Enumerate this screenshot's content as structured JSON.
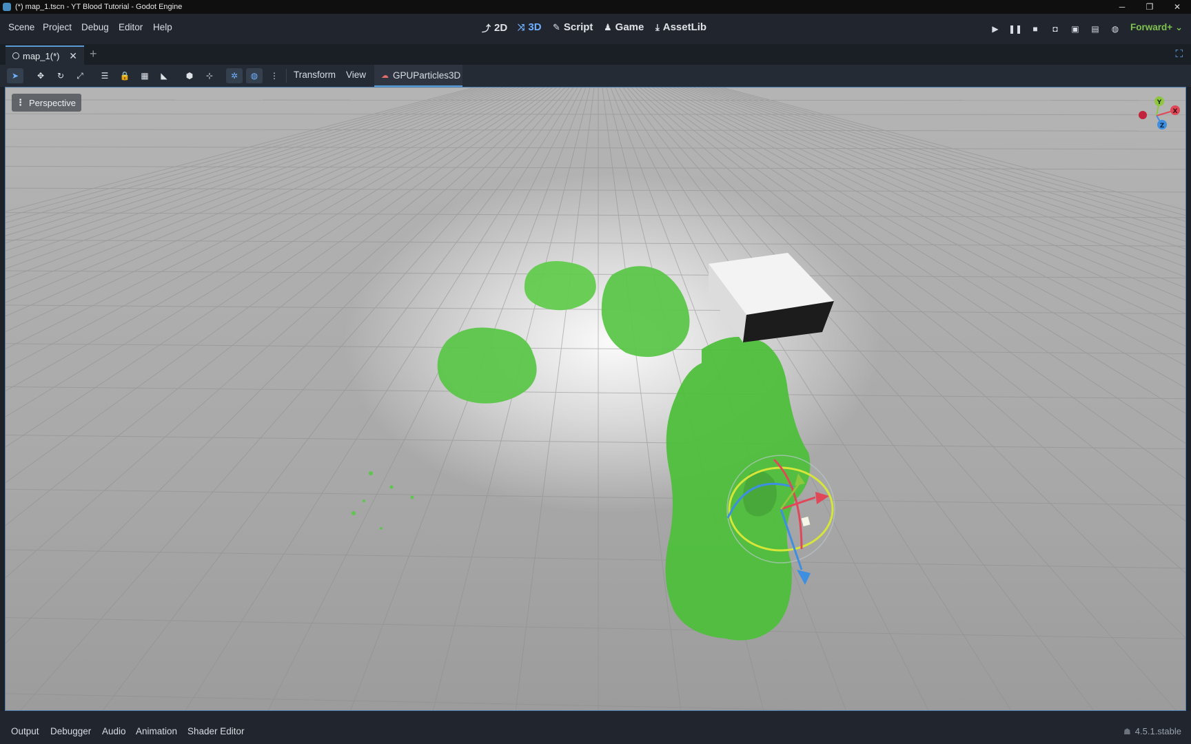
{
  "window": {
    "title": "(*) map_1.tscn - YT Blood Tutorial - Godot Engine",
    "buttons": [
      "─",
      "❐",
      "✕"
    ]
  },
  "menu": [
    "Scene",
    "Project",
    "Debug",
    "Editor",
    "Help"
  ],
  "main_tabs": [
    {
      "label": "2D",
      "icon": "2d-icon"
    },
    {
      "label": "3D",
      "icon": "3d-icon",
      "active": true
    },
    {
      "label": "Script",
      "icon": "script-icon"
    },
    {
      "label": "Game",
      "icon": "game-icon"
    },
    {
      "label": "AssetLib",
      "icon": "assetlib-icon"
    }
  ],
  "renderer": "Forward+",
  "scene_tabs": [
    {
      "label": "map_1(*)",
      "active": true
    }
  ],
  "toolbar": {
    "transform_menu": "Transform",
    "view_menu": "View",
    "plugin_tab": "GPUParticles3D"
  },
  "viewport": {
    "perspective_label": "Perspective",
    "gizmo_axes": {
      "x": "X",
      "y": "Y",
      "z": "Z"
    },
    "colors": {
      "x": "#e04858",
      "y": "#8ec73e",
      "z": "#3f8fe0",
      "particles": "#4fbf3c",
      "selection": "#4c7fb0"
    }
  },
  "bottom_panel": {
    "tabs": [
      "Output",
      "Debugger",
      "Audio",
      "Animation",
      "Shader Editor"
    ],
    "version": "4.5.1.stable"
  }
}
